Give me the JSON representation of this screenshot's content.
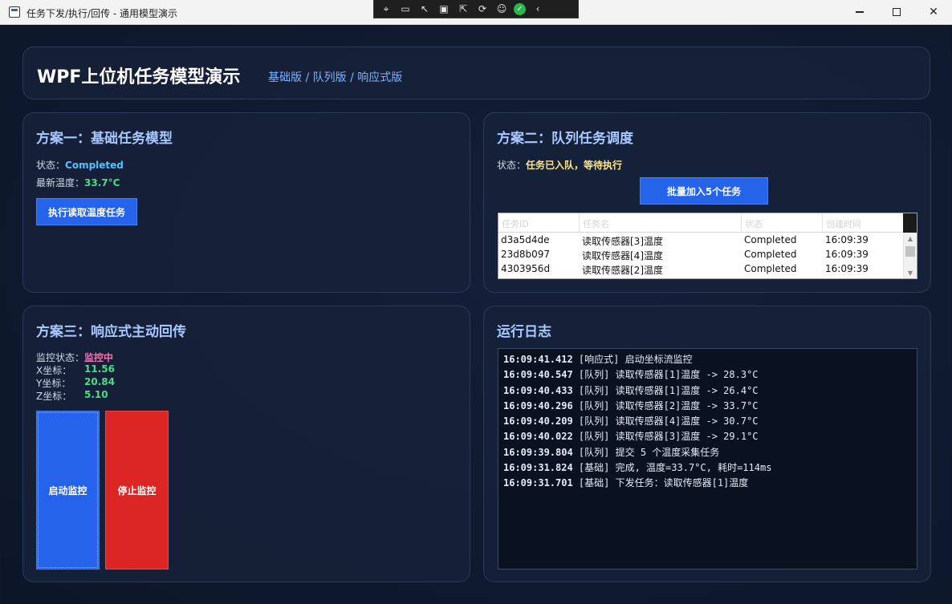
{
  "window": {
    "title": "任务下发/执行/回传 - 通用模型演示",
    "debug_toolbar_icons": [
      "select-element-icon",
      "record-icon",
      "pointer-icon",
      "frame-icon",
      "hover-select-icon",
      "hot-reload-icon",
      "accessibility-icon",
      "ok-check-icon",
      "collapse-icon"
    ]
  },
  "header": {
    "title": "WPF上位机任务模型演示",
    "subtitle": "基础版 / 队列版 / 响应式版"
  },
  "panel1": {
    "title": "方案一：基础任务模型",
    "status_label": "状态：",
    "status_value": "Completed",
    "temp_label": "最新温度：",
    "temp_value": "33.7°C",
    "button": "执行读取温度任务"
  },
  "panel2": {
    "title": "方案二：队列任务调度",
    "status_label": "状态：",
    "status_value": "任务已入队，等待执行",
    "button": "批量加入5个任务",
    "columns": [
      "任务ID",
      "任务名",
      "状态",
      "创建时间"
    ],
    "rows": [
      {
        "id": "d3a5d4de",
        "name": "读取传感器[3]温度",
        "status": "Completed",
        "time": "16:09:39"
      },
      {
        "id": "23d8b097",
        "name": "读取传感器[4]温度",
        "status": "Completed",
        "time": "16:09:39"
      },
      {
        "id": "4303956d",
        "name": "读取传感器[2]温度",
        "status": "Completed",
        "time": "16:09:39"
      }
    ]
  },
  "panel3": {
    "title": "方案三：响应式主动回传",
    "monitor_label": "监控状态：",
    "monitor_value": "监控中",
    "x_label": "X坐标：",
    "x_value": "11.56",
    "y_label": "Y坐标：",
    "y_value": "20.84",
    "z_label": "Z坐标：",
    "z_value": "5.10",
    "start_button": "启动监控",
    "stop_button": "停止监控"
  },
  "panel4": {
    "title": "运行日志",
    "lines": [
      {
        "ts": "16:09:41.412",
        "msg": " [响应式] 启动坐标流监控"
      },
      {
        "ts": "16:09:40.547",
        "msg": " [队列] 读取传感器[1]温度 -> 28.3°C"
      },
      {
        "ts": "16:09:40.433",
        "msg": " [队列] 读取传感器[1]温度 -> 26.4°C"
      },
      {
        "ts": "16:09:40.296",
        "msg": " [队列] 读取传感器[2]温度 -> 33.7°C"
      },
      {
        "ts": "16:09:40.209",
        "msg": " [队列] 读取传感器[4]温度 -> 30.7°C"
      },
      {
        "ts": "16:09:40.022",
        "msg": " [队列] 读取传感器[3]温度 -> 29.1°C"
      },
      {
        "ts": "16:09:39.804",
        "msg": " [队列] 提交 5 个温度采集任务"
      },
      {
        "ts": "16:09:31.824",
        "msg": " [基础] 完成, 温度=33.7°C, 耗时=114ms"
      },
      {
        "ts": "16:09:31.701",
        "msg": " [基础] 下发任务：读取传感器[1]温度"
      }
    ]
  },
  "colors": {
    "accent_blue": "#2563eb",
    "stop_red": "#dc2626",
    "title_text": "#a9c8ff",
    "status_cyan": "#4fc3ff",
    "value_green": "#4ade80",
    "status_yellow": "#fde68a",
    "monitor_pink": "#f472b6"
  }
}
